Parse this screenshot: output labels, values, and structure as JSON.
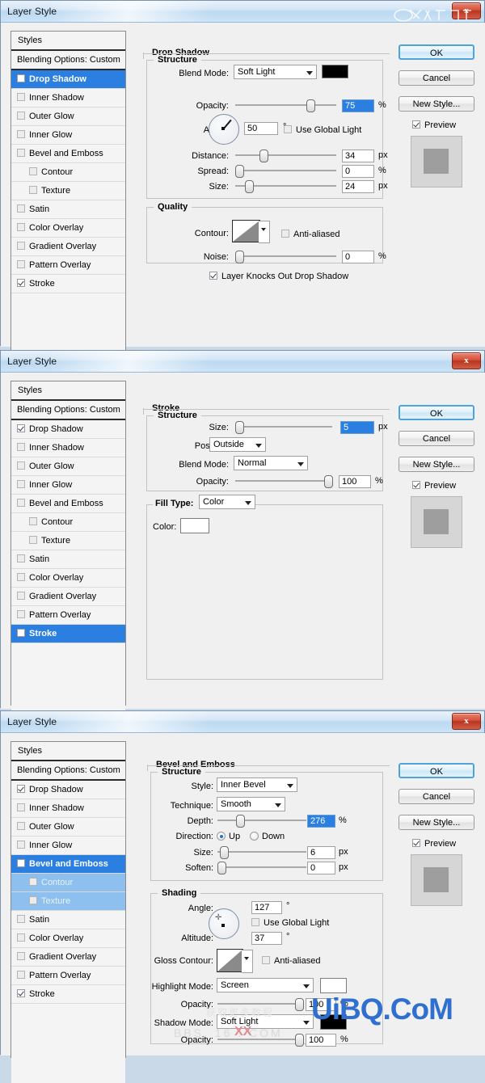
{
  "app": {
    "title": "Layer Style",
    "close_label": "x"
  },
  "styles_panel": {
    "header": "Styles",
    "blending_options": "Blending Options: Custom",
    "items": [
      "Drop Shadow",
      "Inner Shadow",
      "Outer Glow",
      "Inner Glow",
      "Bevel and Emboss",
      "Contour",
      "Texture",
      "Satin",
      "Color Overlay",
      "Gradient Overlay",
      "Pattern Overlay",
      "Stroke"
    ]
  },
  "buttons": {
    "ok": "OK",
    "cancel": "Cancel",
    "new_style": "New Style...",
    "preview": "Preview"
  },
  "dialog1": {
    "section_title": "Drop Shadow",
    "structure_title": "Structure",
    "quality_title": "Quality",
    "blend_mode_label": "Blend Mode:",
    "blend_mode_value": "Soft Light",
    "blend_mode_color": "#000000",
    "opacity_label": "Opacity:",
    "opacity_value": "75",
    "opacity_unit": "%",
    "angle_label": "Angle:",
    "angle_value": "50",
    "angle_unit": "°",
    "use_global_light": "Use Global Light",
    "distance_label": "Distance:",
    "distance_value": "34",
    "distance_unit": "px",
    "spread_label": "Spread:",
    "spread_value": "0",
    "spread_unit": "%",
    "size_label": "Size:",
    "size_value": "24",
    "size_unit": "px",
    "contour_label": "Contour:",
    "anti_aliased": "Anti-aliased",
    "noise_label": "Noise:",
    "noise_value": "0",
    "noise_unit": "%",
    "knocks_out": "Layer Knocks Out Drop Shadow"
  },
  "dialog2": {
    "section_title": "Stroke",
    "structure_title": "Structure",
    "size_label": "Size:",
    "size_value": "5",
    "size_unit": "px",
    "position_label": "Position:",
    "position_value": "Outside",
    "blend_mode_label": "Blend Mode:",
    "blend_mode_value": "Normal",
    "opacity_label": "Opacity:",
    "opacity_value": "100",
    "opacity_unit": "%",
    "fill_type_label": "Fill Type:",
    "fill_type_value": "Color",
    "color_label": "Color:",
    "color_value": "#ffffff"
  },
  "dialog3": {
    "section_title": "Bevel and Emboss",
    "structure_title": "Structure",
    "shading_title": "Shading",
    "style_label": "Style:",
    "style_value": "Inner Bevel",
    "technique_label": "Technique:",
    "technique_value": "Smooth",
    "depth_label": "Depth:",
    "depth_value": "276",
    "depth_unit": "%",
    "direction_label": "Direction:",
    "direction_up": "Up",
    "direction_down": "Down",
    "size_label": "Size:",
    "size_value": "6",
    "size_unit": "px",
    "soften_label": "Soften:",
    "soften_value": "0",
    "soften_unit": "px",
    "angle_label": "Angle:",
    "angle_value": "127",
    "angle_unit": "°",
    "use_global_light": "Use Global Light",
    "altitude_label": "Altitude:",
    "altitude_value": "37",
    "altitude_unit": "°",
    "gloss_contour_label": "Gloss Contour:",
    "anti_aliased": "Anti-aliased",
    "highlight_mode_label": "Highlight Mode:",
    "highlight_mode_value": "Screen",
    "highlight_color": "#ffffff",
    "highlight_opacity_label": "Opacity:",
    "highlight_opacity_value": "100",
    "highlight_opacity_unit": "%",
    "shadow_mode_label": "Shadow Mode:",
    "shadow_mode_value": "Soft Light",
    "shadow_color": "#000000",
    "shadow_opacity_label": "Opacity:",
    "shadow_opacity_value": "100",
    "shadow_opacity_unit": "%"
  },
  "watermarks": {
    "bottom": "UiBQ.CoM",
    "faint_bbs": "BBS. 16     . COM",
    "faint_xx": "XX"
  }
}
